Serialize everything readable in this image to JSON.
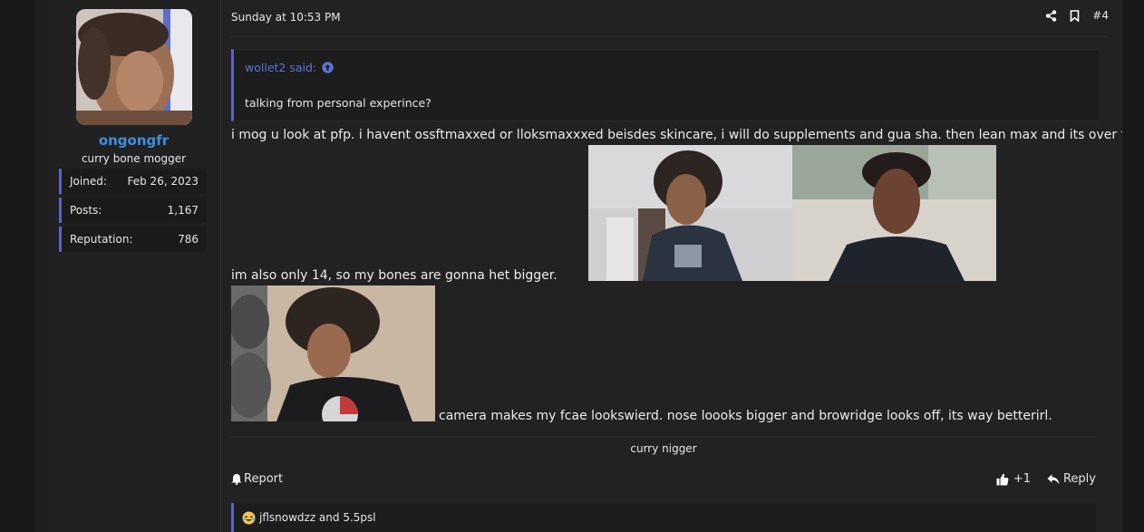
{
  "user": {
    "username": "ongongfr",
    "title": "curry bone mogger",
    "stats": [
      {
        "label": "Joined:",
        "value": "Feb 26, 2023"
      },
      {
        "label": "Posts:",
        "value": "1,167"
      },
      {
        "label": "Reputation:",
        "value": "786"
      }
    ]
  },
  "post": {
    "date": "Sunday at 10:53 PM",
    "number": "#4",
    "quote": {
      "author": "wollet2 said:",
      "text": "talking from personal experince?"
    },
    "line1": "i mog u look at pfp. i havent ossftmaxxed or lloksmaxxxed beisdes skincare, i will do supplements and gua sha. then lean max and its over for u.",
    "line2": "im also only 14, so my bones are gonna het bigger.",
    "line3": "camera makes my fcae lookswierd. nose loooks bigger and browridge looks off, its way betterirl.",
    "signature": "curry nigger"
  },
  "footer": {
    "report": "Report",
    "reaction_count": "+1",
    "reply": "Reply"
  },
  "reactions": {
    "text": "jflsnowdzz and 5.5psl"
  },
  "colors": {
    "accent": "#5b63c7",
    "username": "#3d8fe0",
    "quote_author": "#5b73d6"
  },
  "icons": [
    "share-icon",
    "bookmark-icon",
    "arrow-up-circle-icon",
    "bell-icon",
    "thumbs-up-icon",
    "reply-arrow-icon",
    "laughing-emoji-icon"
  ]
}
